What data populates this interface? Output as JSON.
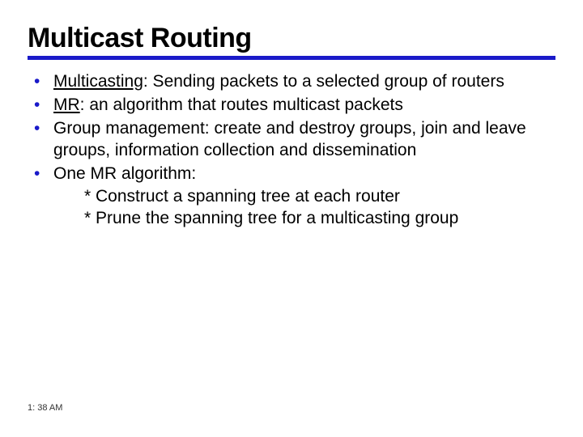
{
  "title": "Multicast Routing",
  "bullets": [
    {
      "term": "Multicasting",
      "rest": ": Sending packets to a selected group of routers"
    },
    {
      "term": "MR",
      "rest": ": an algorithm that routes multicast packets"
    },
    {
      "term": "",
      "rest": "Group management: create and destroy groups, join and leave groups, information collection and dissemination"
    },
    {
      "term": "",
      "rest": "One MR algorithm:"
    }
  ],
  "subs": [
    "* Construct a spanning tree at each router",
    "* Prune the spanning tree for a multicasting group"
  ],
  "timestamp": "1: 38 AM"
}
